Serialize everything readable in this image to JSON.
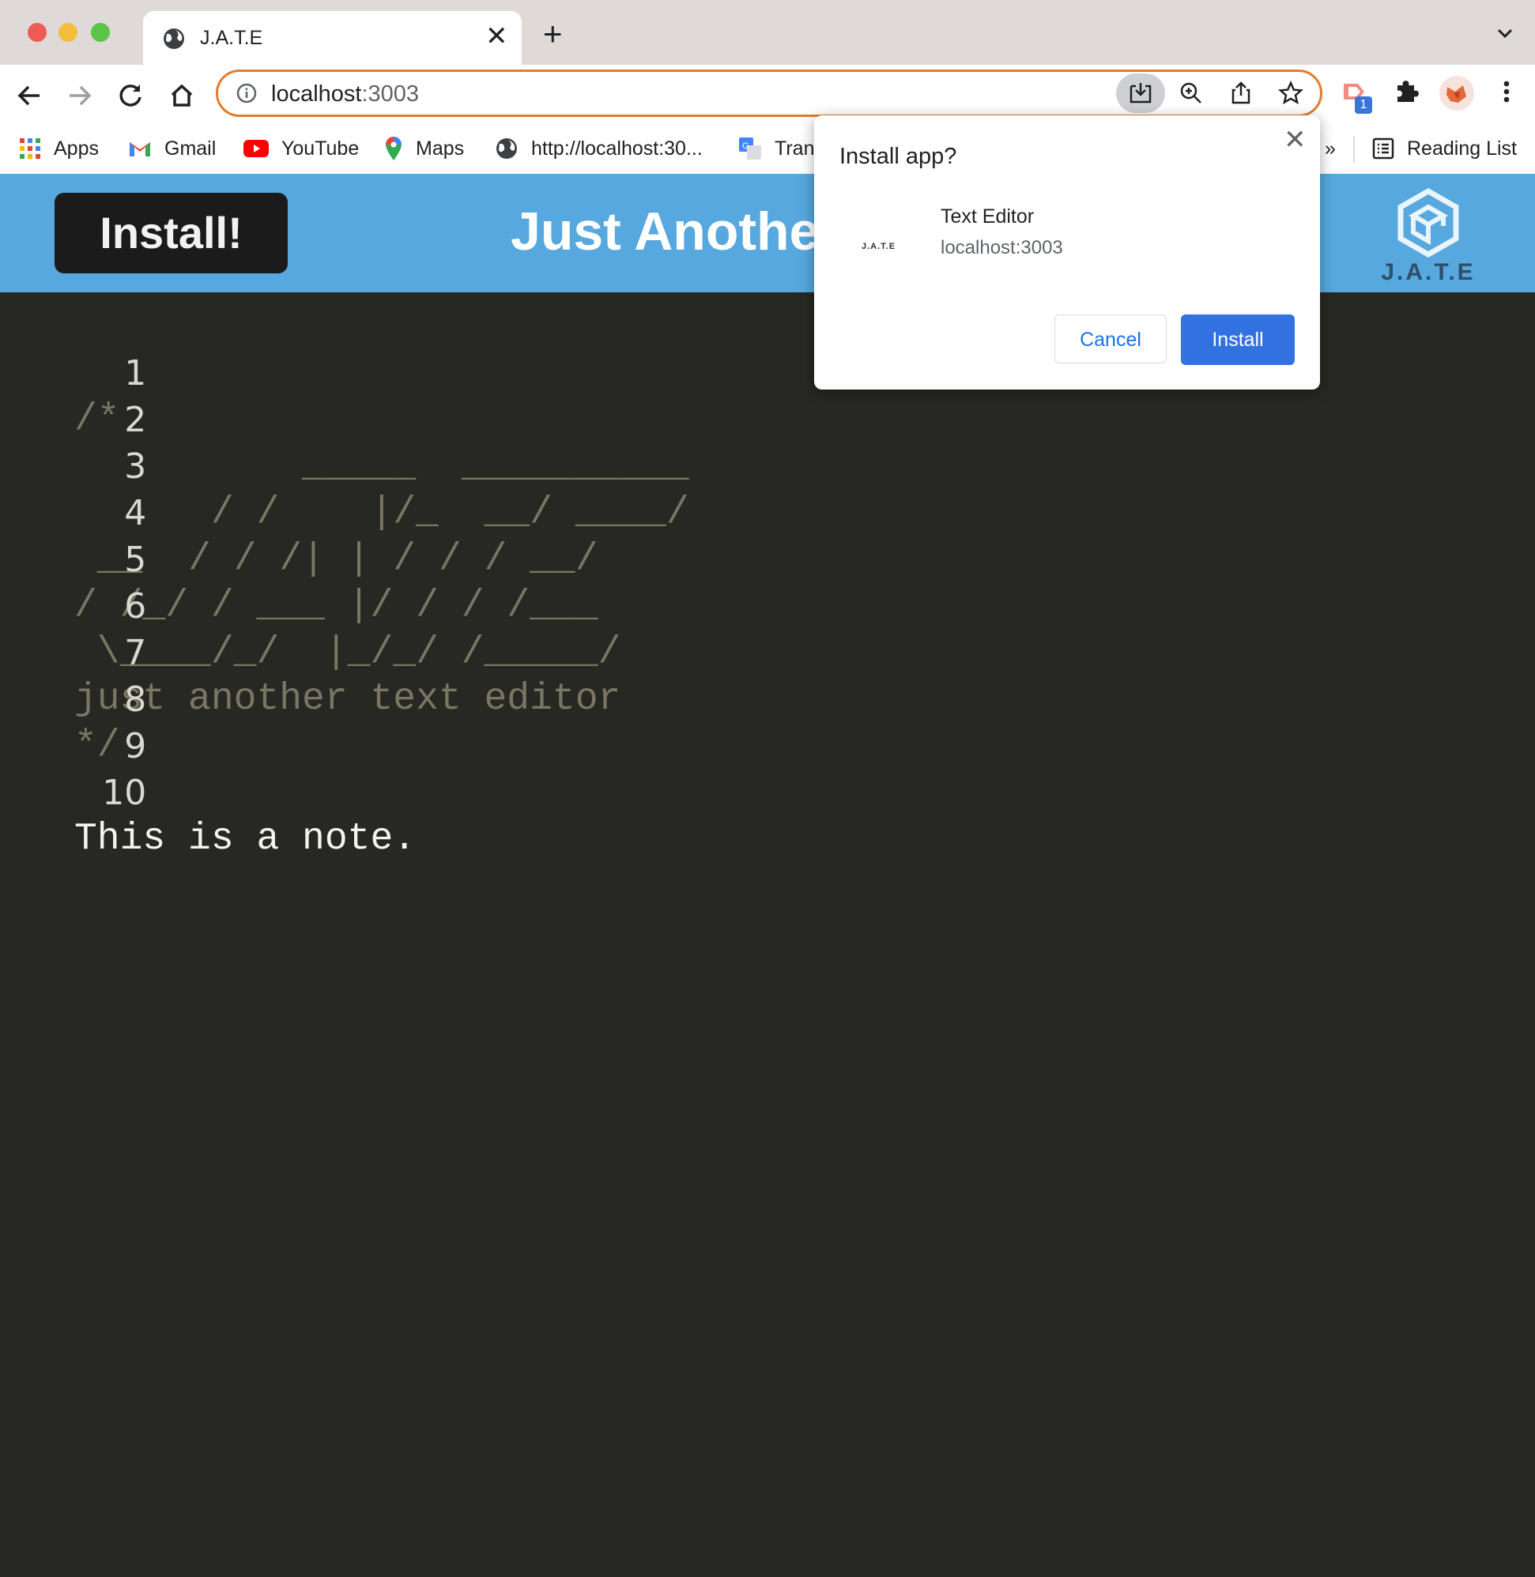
{
  "browser": {
    "tab_title": "J.A.T.E",
    "url_host": "localhost",
    "url_port": ":3003",
    "extension_badge": "1"
  },
  "bookmarks": [
    {
      "label": "Apps",
      "icon": "apps-grid-icon"
    },
    {
      "label": "Gmail",
      "icon": "gmail-icon"
    },
    {
      "label": "YouTube",
      "icon": "youtube-icon"
    },
    {
      "label": "Maps",
      "icon": "maps-icon"
    },
    {
      "label": "http://localhost:30...",
      "icon": "globe-icon"
    },
    {
      "label": "Tran",
      "icon": "translate-icon"
    },
    {
      "label": "»",
      "icon": "more-icon"
    },
    {
      "label": "Reading List",
      "icon": "reading-list-icon"
    }
  ],
  "app": {
    "install_button": "Install!",
    "title": "Just Anothe",
    "logo_text": "J.A.T.E"
  },
  "editor": {
    "lines": [
      {
        "n": "1",
        "text": "/*"
      },
      {
        "n": "2",
        "text": "          _____  __________"
      },
      {
        "n": "3",
        "text": "      / /    |/_  __/ ____/"
      },
      {
        "n": "4",
        "text": " __  / / /| | / / / __/"
      },
      {
        "n": "5",
        "text": "/ /_/ / ___ |/ / / /___"
      },
      {
        "n": "6",
        "text": " \\____/_/  |_/_/ /_____/"
      },
      {
        "n": "7",
        "text": "just another text editor"
      },
      {
        "n": "8",
        "text": "*/"
      },
      {
        "n": "9",
        "text": ""
      },
      {
        "n": "10",
        "text": "This is a note."
      }
    ]
  },
  "dialog": {
    "title": "Install app?",
    "app_name": "Text Editor",
    "app_url": "localhost:3003",
    "icon_text": "J.A.T.E",
    "cancel": "Cancel",
    "install": "Install"
  },
  "colors": {
    "header_bg": "#56a8de",
    "editor_bg": "#272823",
    "comment": "#7a7663",
    "accent_install": "#3272e0",
    "omnibox_focus": "#e37b2c"
  }
}
